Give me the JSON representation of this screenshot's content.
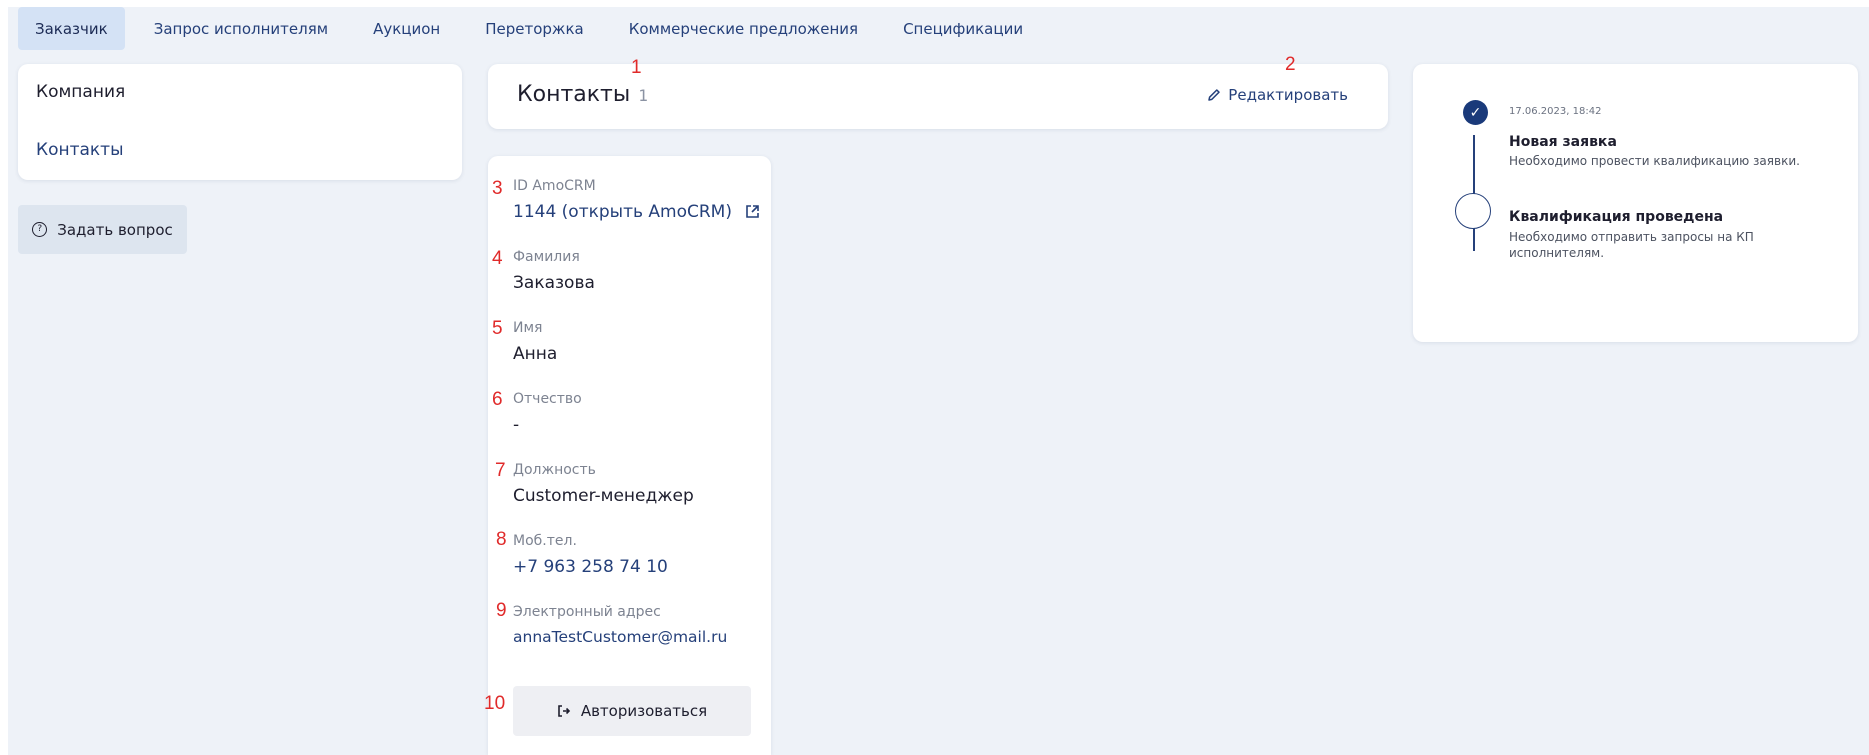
{
  "tabs": [
    {
      "label": "Заказчик",
      "active": true
    },
    {
      "label": "Запрос исполнителям"
    },
    {
      "label": "Аукцион"
    },
    {
      "label": "Переторжка"
    },
    {
      "label": "Коммерческие предложения"
    },
    {
      "label": "Спецификации"
    }
  ],
  "sidebar": {
    "items": [
      {
        "label": "Компания"
      },
      {
        "label": "Контакты",
        "active": true
      }
    ],
    "ask_button": "Задать вопрос"
  },
  "header": {
    "title": "Контакты",
    "count": "1",
    "edit_label": "Редактировать"
  },
  "contact": {
    "fields": [
      {
        "label": "ID AmoCRM",
        "value": "1144 (открыть AmoCRM)"
      },
      {
        "label": "Фамилия",
        "value": "Заказова"
      },
      {
        "label": "Имя",
        "value": "Анна"
      },
      {
        "label": "Отчество",
        "value": "-"
      },
      {
        "label": "Должность",
        "value": "Customer-менеджер"
      },
      {
        "label": "Моб.тел.",
        "value": "+7 963 258 74 10"
      },
      {
        "label": "Электронный адрес",
        "value": "annaTestCustomer@mail.ru"
      }
    ],
    "auth_button": "Авторизоваться"
  },
  "timeline": [
    {
      "date": "17.06.2023, 18:42",
      "title": "Новая заявка",
      "description": "Необходимо провести квалификацию заявки.",
      "status": "done"
    },
    {
      "title": "Квалификация проведена",
      "description": "Необходимо отправить запросы на КП исполнителям.",
      "status": "pending"
    }
  ],
  "annotations": [
    "1",
    "2",
    "3",
    "4",
    "5",
    "6",
    "7",
    "8",
    "9",
    "10"
  ],
  "colors": {
    "accent": "#25407a",
    "annotation": "#e02a2a",
    "background": "#eef2f8",
    "active_tab": "#d4e2f5"
  }
}
